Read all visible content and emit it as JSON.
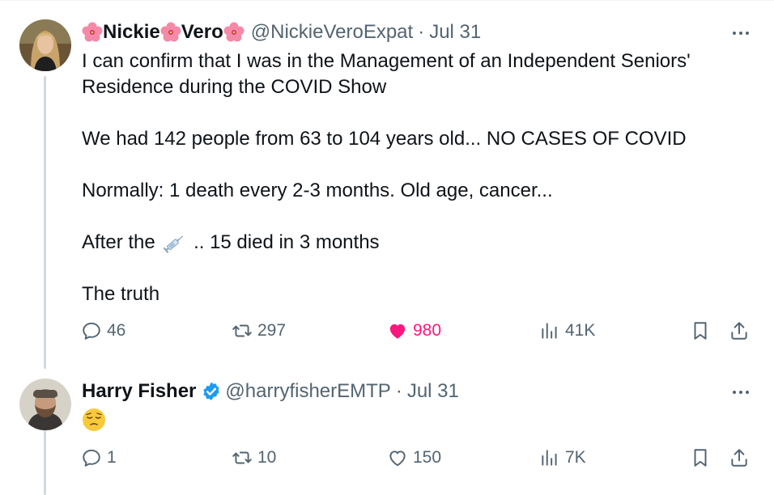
{
  "tweet1": {
    "display_name_parts": [
      "Nickie",
      "Vero"
    ],
    "handle": "@NickieVeroExpat",
    "separator": "·",
    "date": "Jul 31",
    "lines": [
      "I can confirm that I was in the Management of an Independent Seniors'",
      "Residence during the COVID Show",
      "",
      "We had 142 people from 63 to 104 years old... NO CASES OF COVID",
      "",
      "Normally: 1 death every 2-3 months. Old age, cancer...",
      "",
      "After the",
      "",
      "The truth"
    ],
    "syringe_line_prefix": "After the",
    "syringe_line_suffix": ".. 15 died in 3 months",
    "replies": "46",
    "reposts": "297",
    "likes": "980",
    "views": "41K",
    "liked_color": "#f91880"
  },
  "tweet2": {
    "display_name": "Harry Fisher",
    "handle": "@harryfisherEMTP",
    "separator": "·",
    "date": "Jul 31",
    "emoji": "😔",
    "replies": "1",
    "reposts": "10",
    "likes": "150",
    "views": "7K"
  },
  "colors": {
    "muted": "#536471",
    "text": "#0f1419",
    "verified": "#1d9bf0",
    "thread": "#cfd9de"
  },
  "icons": [
    "hibiscus-icon",
    "reply-icon",
    "repost-icon",
    "heart-icon",
    "views-icon",
    "bookmark-icon",
    "share-icon",
    "more-icon",
    "verified-badge-icon",
    "syringe-icon"
  ]
}
